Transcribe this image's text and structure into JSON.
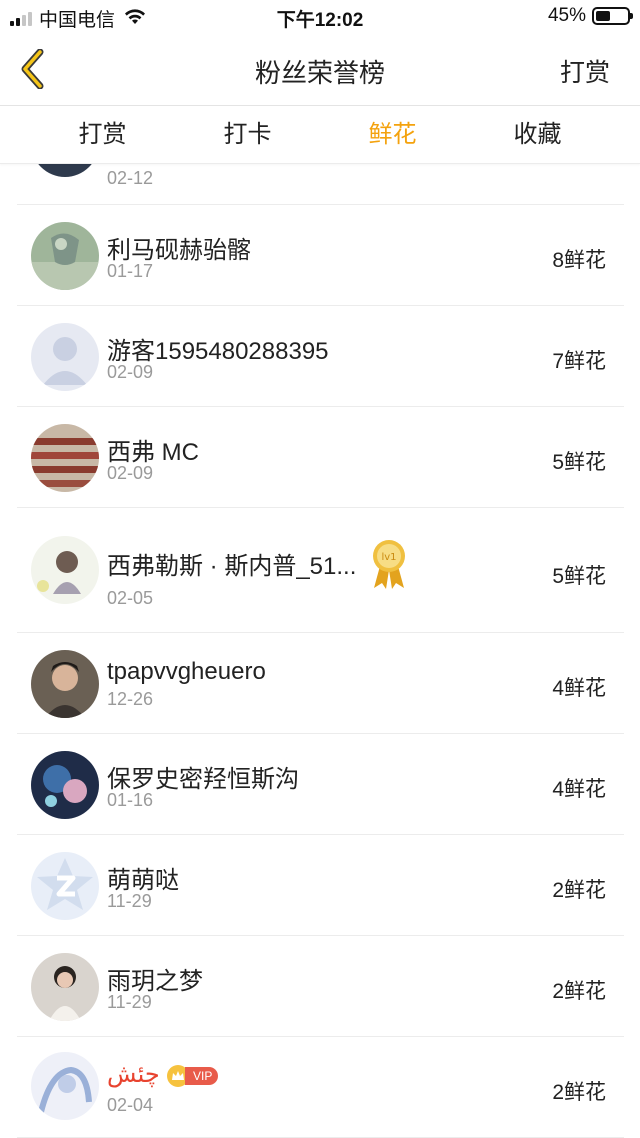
{
  "status_bar": {
    "carrier": "中国电信",
    "time": "下午12:02",
    "battery_percent": "45%",
    "battery_level": 0.45,
    "icons": [
      "signal-icon",
      "wifi-icon",
      "battery-icon"
    ]
  },
  "nav": {
    "title": "粉丝荣誉榜",
    "right_action": "打赏",
    "back_icon": "chevron-left-icon",
    "accent_color": "#f4a20d"
  },
  "tabs": [
    {
      "label": "打赏",
      "active": false
    },
    {
      "label": "打卡",
      "active": false
    },
    {
      "label": "鲜花",
      "active": true
    },
    {
      "label": "收藏",
      "active": false
    }
  ],
  "entries": [
    {
      "name": "",
      "date": "02-12",
      "count": ""
    },
    {
      "name": "利马砚赫骀髂",
      "date": "01-17",
      "count": "8鲜花"
    },
    {
      "name": "游客1595480288395",
      "date": "02-09",
      "count": "7鲜花"
    },
    {
      "name": "西弗 MC",
      "date": "02-09",
      "count": "5鲜花"
    },
    {
      "name": "西弗勒斯 · 斯内普_51...",
      "date": "02-05",
      "count": "5鲜花",
      "badge": "lv1"
    },
    {
      "name": "tpapvvgheuero",
      "date": "12-26",
      "count": "4鲜花"
    },
    {
      "name": "保罗史密羟恒斯沟",
      "date": "01-16",
      "count": "4鲜花"
    },
    {
      "name": "萌萌哒",
      "date": "11-29",
      "count": "2鲜花"
    },
    {
      "name": "雨玥之梦",
      "date": "11-29",
      "count": "2鲜花"
    },
    {
      "name": "چئش",
      "date": "02-04",
      "count": "2鲜花",
      "badge": "VIP"
    }
  ]
}
